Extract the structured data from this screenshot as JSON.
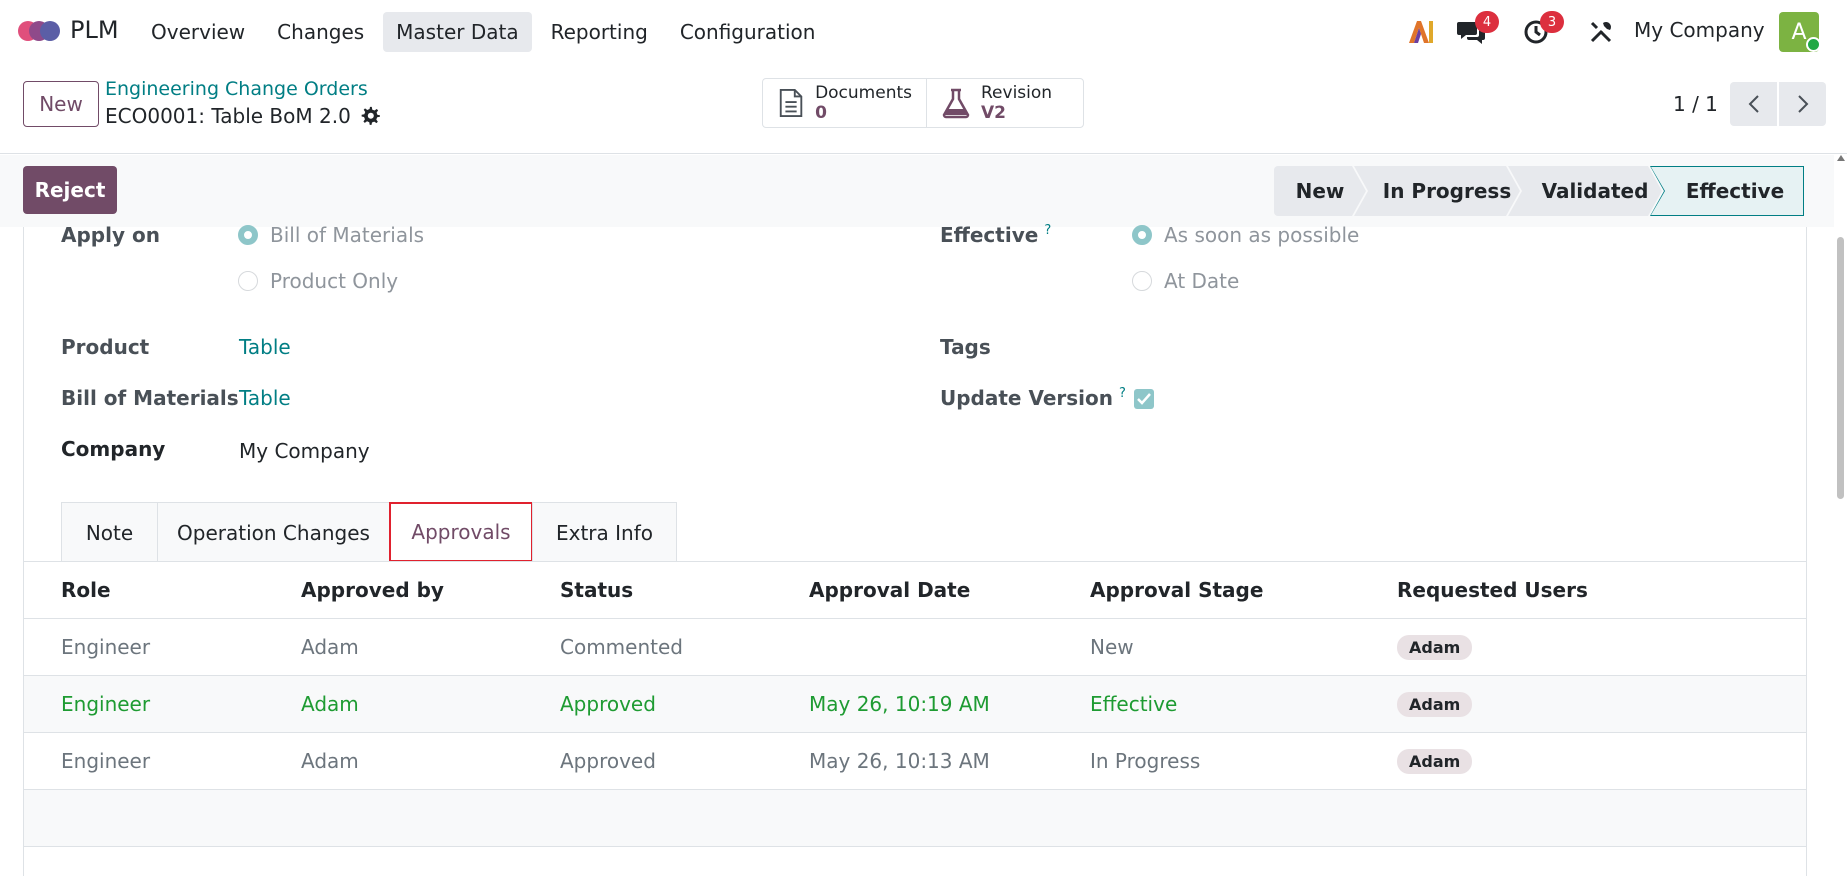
{
  "app": {
    "name": "PLM",
    "menu": [
      "Overview",
      "Changes",
      "Master Data",
      "Reporting",
      "Configuration"
    ],
    "active_menu": "Master Data",
    "messages_badge": "4",
    "activities_badge": "3",
    "company": "My Company",
    "avatar_letter": "A"
  },
  "control": {
    "new_label": "New",
    "breadcrumb": "Engineering Change Orders",
    "record_title": "ECO0001: Table BoM 2.0",
    "documents_label": "Documents",
    "documents_count": "0",
    "revision_label": "Revision",
    "revision_value": "V2",
    "pager": "1 / 1"
  },
  "statusbar": {
    "reject_label": "Reject",
    "stages": [
      "New",
      "In Progress",
      "Validated",
      "Effective"
    ],
    "current_stage": "Effective"
  },
  "form": {
    "apply_on_label": "Apply on",
    "apply_on_options": [
      "Bill of Materials",
      "Product Only"
    ],
    "apply_on_selected": "Bill of Materials",
    "effective_label": "Effective",
    "effective_help": "?",
    "effective_options": [
      "As soon as possible",
      "At Date"
    ],
    "effective_selected": "As soon as possible",
    "product_label": "Product",
    "product_value": "Table",
    "bom_label": "Bill of Materials",
    "bom_value": "Table",
    "company_label": "Company",
    "company_value": "My Company",
    "tags_label": "Tags",
    "update_version_label": "Update Version",
    "update_version_help": "?",
    "update_version_checked": true
  },
  "tabs": [
    "Note",
    "Operation Changes",
    "Approvals",
    "Extra Info"
  ],
  "active_tab": "Approvals",
  "approvals": {
    "columns": [
      "Role",
      "Approved by",
      "Status",
      "Approval Date",
      "Approval Stage",
      "Requested Users"
    ],
    "rows": [
      {
        "role": "Engineer",
        "approved_by": "Adam",
        "status": "Commented",
        "date": "",
        "stage": "New",
        "users": "Adam"
      },
      {
        "role": "Engineer",
        "approved_by": "Adam",
        "status": "Approved",
        "date": "May 26, 10:19 AM",
        "stage": "Effective",
        "users": "Adam"
      },
      {
        "role": "Engineer",
        "approved_by": "Adam",
        "status": "Approved",
        "date": "May 26, 10:13 AM",
        "stage": "In Progress",
        "users": "Adam"
      }
    ]
  },
  "colors": {
    "brand": "#714b67",
    "link": "#017e84",
    "success": "#1e9b32",
    "badge": "#dc2f3e"
  }
}
